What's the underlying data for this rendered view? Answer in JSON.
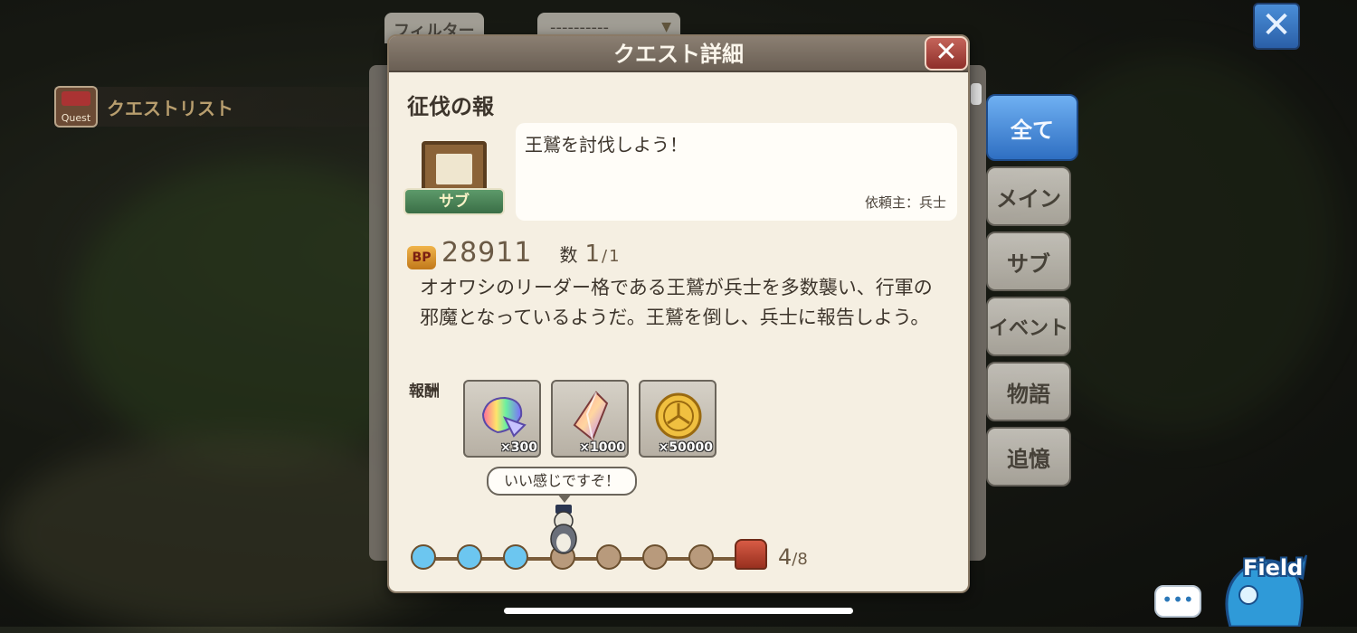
{
  "header_controls": {
    "filter_label": "フィルター",
    "dropdown_value": "----------"
  },
  "quest_list": {
    "title": "クエストリスト",
    "icon_label": "Quest"
  },
  "side_tabs": [
    {
      "label": "全て",
      "active": true
    },
    {
      "label": "メイン",
      "active": false
    },
    {
      "label": "サブ",
      "active": false
    },
    {
      "label": "イベント",
      "active": false
    },
    {
      "label": "物語",
      "active": false
    },
    {
      "label": "追憶",
      "active": false
    }
  ],
  "modal": {
    "title": "クエスト詳細",
    "quest_name": "征伐の報",
    "type_badge": "サブ",
    "message": "王鷲を討伐しよう！",
    "client": "依頼主：兵士",
    "bp_icon": "BP",
    "bp_value": "28911",
    "count_label": "数",
    "count_current": "1",
    "count_total": "1",
    "description": "オオワシのリーダー格である王鷲が兵士を多数襲い、行軍の邪魔となっているようだ。王鷲を倒し、兵士に報告しよう。",
    "reward_label": "報酬",
    "rewards": [
      {
        "icon": "rainbow-gem-icon",
        "qty": "×300"
      },
      {
        "icon": "crystal-icon",
        "qty": "×1000"
      },
      {
        "icon": "gold-coin-icon",
        "qty": "×50000"
      }
    ],
    "speech": "いい感じですぞ！",
    "progress": {
      "current": "4",
      "total": "8",
      "completed_steps": 3,
      "steps": 7
    }
  },
  "field_button": {
    "label": "Field"
  },
  "colors": {
    "active_tab": "#2f6fc2",
    "progress_done": "#6cc6f0",
    "close_red": "#8e2f2a"
  }
}
